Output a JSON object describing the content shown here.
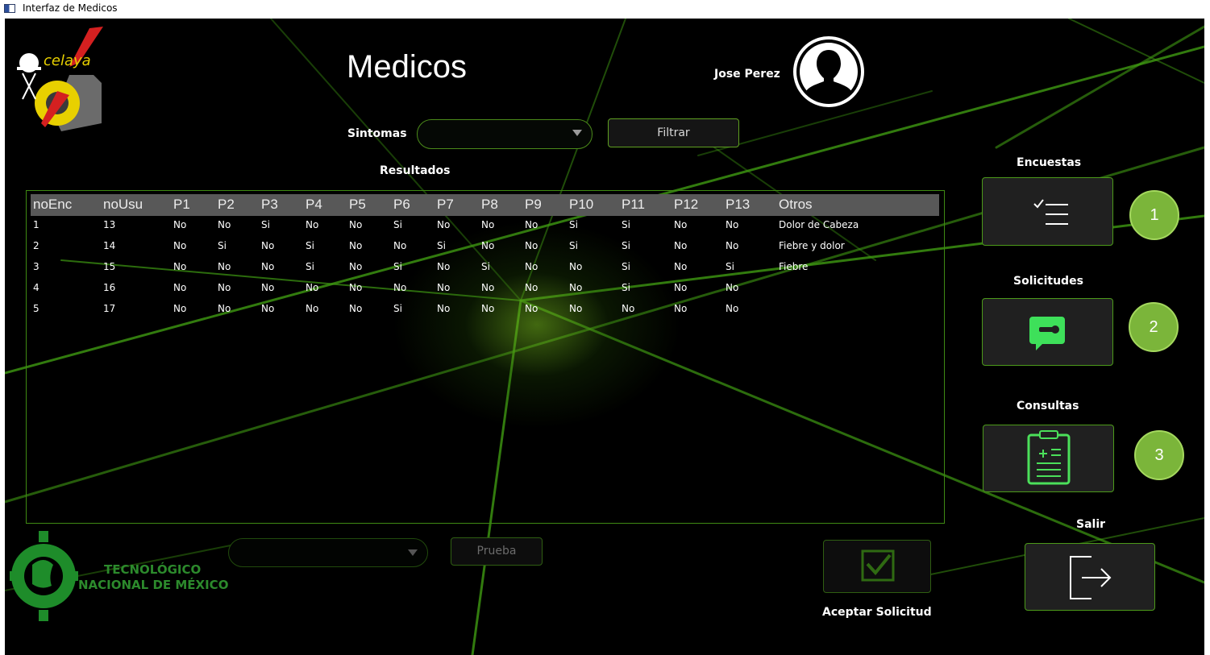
{
  "window": {
    "title": "Interfaz de Medicos"
  },
  "header": {
    "title": "Medicos",
    "user_name": "Jose Perez"
  },
  "filter": {
    "label": "Sintomas",
    "selected": "",
    "button": "Filtrar"
  },
  "results": {
    "title": "Resultados",
    "columns": [
      "noEnc",
      "noUsu",
      "P1",
      "P2",
      "P3",
      "P4",
      "P5",
      "P6",
      "P7",
      "P8",
      "P9",
      "P10",
      "P11",
      "P12",
      "P13",
      "Otros"
    ],
    "rows": [
      [
        "1",
        "13",
        "No",
        "No",
        "Si",
        "No",
        "No",
        "Si",
        "No",
        "No",
        "No",
        "Si",
        "Si",
        "No",
        "No",
        "Dolor de Cabeza"
      ],
      [
        "2",
        "14",
        "No",
        "Si",
        "No",
        "Si",
        "No",
        "No",
        "Si",
        "No",
        "No",
        "Si",
        "Si",
        "No",
        "No",
        "Fiebre y dolor"
      ],
      [
        "3",
        "15",
        "No",
        "No",
        "No",
        "Si",
        "No",
        "Si",
        "No",
        "Si",
        "No",
        "No",
        "Si",
        "No",
        "Si",
        "Fiebre"
      ],
      [
        "4",
        "16",
        "No",
        "No",
        "No",
        "No",
        "No",
        "No",
        "No",
        "No",
        "No",
        "No",
        "Si",
        "No",
        "No",
        ""
      ],
      [
        "5",
        "17",
        "No",
        "No",
        "No",
        "No",
        "No",
        "Si",
        "No",
        "No",
        "No",
        "No",
        "No",
        "No",
        "No",
        ""
      ]
    ]
  },
  "sidebar": {
    "encuestas": {
      "label": "Encuestas",
      "badge": "1"
    },
    "solicitudes": {
      "label": "Solicitudes",
      "badge": "2"
    },
    "consultas": {
      "label": "Consultas",
      "badge": "3"
    },
    "salir": {
      "label": "Salir"
    }
  },
  "bottom": {
    "combo_selected": "",
    "test_button": "Prueba",
    "accept_label": "Aceptar Solicitud"
  },
  "logos": {
    "top_text": "celaya",
    "tec_line1": "TECNOLÓGICO",
    "tec_line2": "NACIONAL DE MÉXICO"
  },
  "colors": {
    "accent": "#5fa021",
    "badge": "#7bb53a",
    "background": "#000000"
  }
}
